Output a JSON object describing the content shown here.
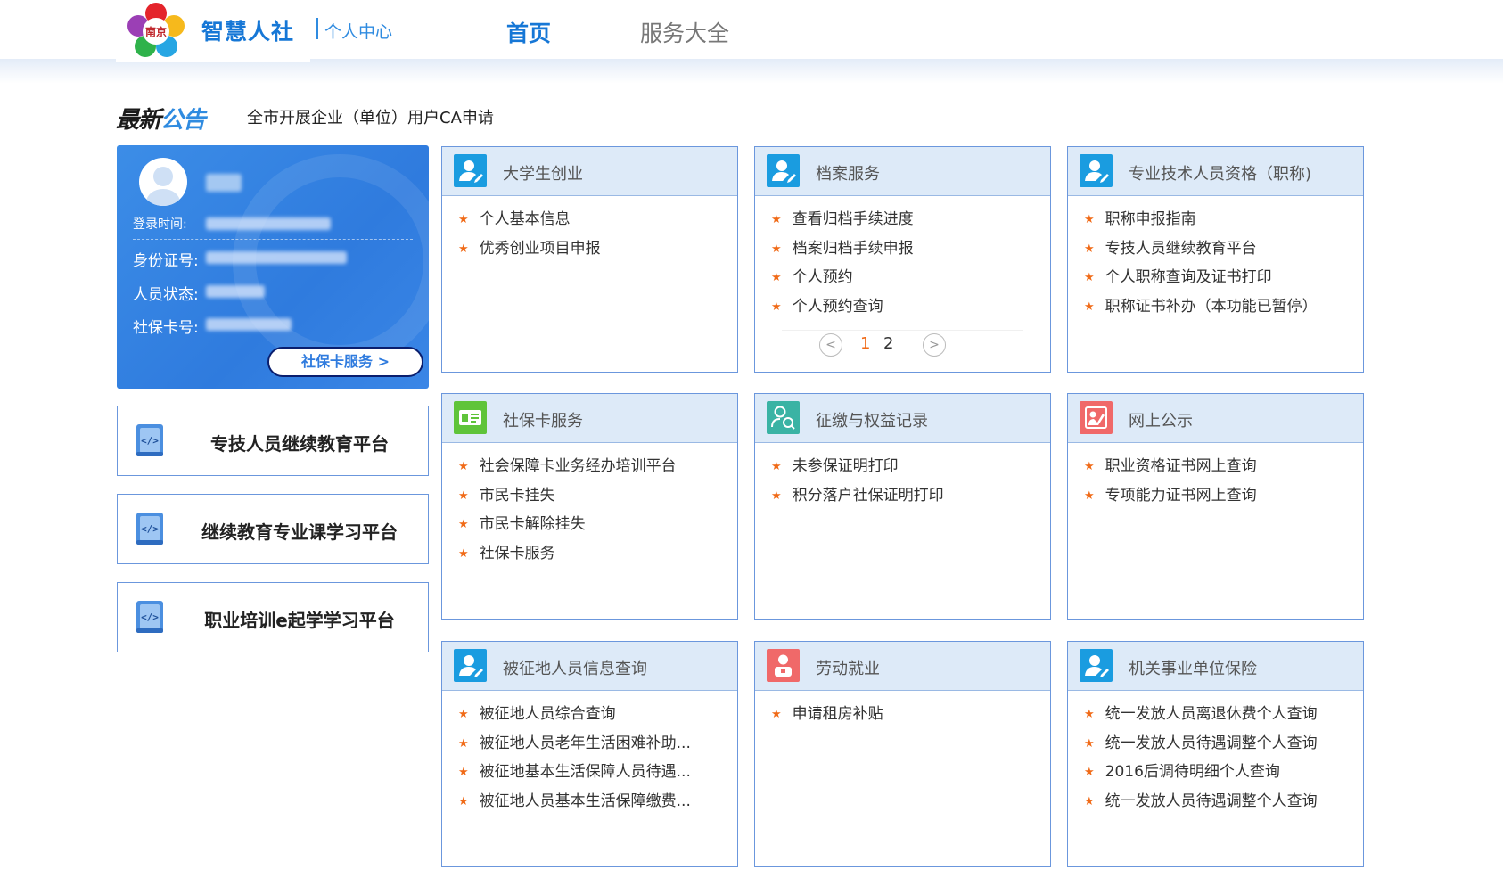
{
  "header": {
    "brand_title": "智慧人社",
    "brand_sub": "个人中心",
    "nav": [
      {
        "label": "首页",
        "active": true
      },
      {
        "label": "服务大全",
        "active": false
      }
    ],
    "accent_color": "#1677d6"
  },
  "notice": {
    "logo_part1": "最新",
    "logo_part2": "公告",
    "text": "全市开展企业（单位）用户CA申请"
  },
  "user_card": {
    "login_time_label": "登录时间:",
    "id_label": "身份证号:",
    "status_label": "人员状态:",
    "card_label": "社保卡号:",
    "button_label": "社保卡服务 >"
  },
  "platforms": [
    {
      "label": "专技人员继续教育平台",
      "icon": "book-code-icon"
    },
    {
      "label": "继续教育专业课学习平台",
      "icon": "book-code-icon"
    },
    {
      "label": "职业培训e起学学习平台",
      "icon": "book-code-icon"
    }
  ],
  "services": [
    {
      "title": "大学生创业",
      "icon": "user-edit-icon",
      "color": "#1a9ce0",
      "items": [
        "个人基本信息",
        "优秀创业项目申报"
      ]
    },
    {
      "title": "档案服务",
      "icon": "user-edit-icon",
      "color": "#1a9ce0",
      "items": [
        "查看归档手续进度",
        "档案归档手续申报",
        "个人预约",
        "个人预约查询"
      ],
      "pager": {
        "prev": "<",
        "pages": [
          "1",
          "2"
        ],
        "current": "1",
        "next": ">"
      }
    },
    {
      "title": "专业技术人员资格（职称)",
      "icon": "user-edit-icon",
      "color": "#1a9ce0",
      "items": [
        "职称申报指南",
        "专技人员继续教育平台",
        "个人职称查询及证书打印",
        "职称证书补办（本功能已暂停）"
      ]
    },
    {
      "title": "社保卡服务",
      "icon": "id-card-icon",
      "color": "#5fc43a",
      "items": [
        "社会保障卡业务经办培训平台",
        "市民卡挂失",
        "市民卡解除挂失",
        "社保卡服务"
      ]
    },
    {
      "title": "征缴与权益记录",
      "icon": "user-search-icon",
      "color": "#3ab3a4",
      "items": [
        "未参保证明打印",
        "积分落户社保证明打印"
      ]
    },
    {
      "title": "网上公示",
      "icon": "user-announce-icon",
      "color": "#f06969",
      "items": [
        "职业资格证书网上查询",
        "专项能力证书网上查询"
      ]
    },
    {
      "title": "被征地人员信息查询",
      "icon": "user-edit-icon",
      "color": "#1a9ce0",
      "items": [
        "被征地人员综合查询",
        "被征地人员老年生活困难补助...",
        "被征地基本生活保障人员待遇...",
        "被征地人员基本生活保障缴费..."
      ]
    },
    {
      "title": "劳动就业",
      "icon": "user-worker-icon",
      "color": "#f06969",
      "items": [
        "申请租房补贴"
      ]
    },
    {
      "title": "机关事业单位保险",
      "icon": "user-edit-icon",
      "color": "#1a9ce0",
      "items": [
        "统一发放人员离退休费个人查询",
        "统一发放人员待遇调整个人查询",
        "2016后调待明细个人查询",
        "统一发放人员待遇调整个人查询"
      ]
    }
  ]
}
